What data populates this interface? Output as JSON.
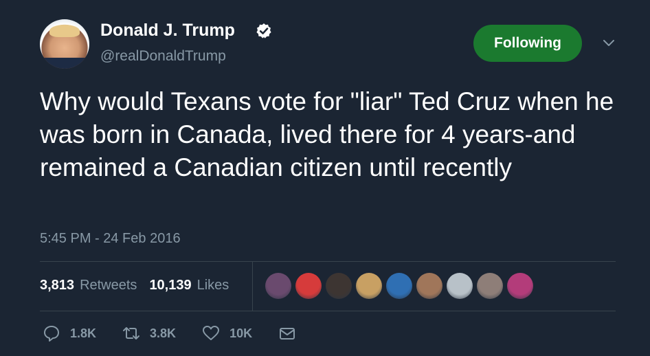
{
  "author": {
    "name": "Donald J. Trump",
    "handle": "@realDonaldTrump"
  },
  "follow_button": {
    "label": "Following"
  },
  "tweet": {
    "text": "Why would Texans vote for \"liar\" Ted Cruz when he was born in Canada, lived there for 4 years-and remained a Canadian citizen until recently",
    "timestamp": "5:45 PM - 24 Feb 2016"
  },
  "stats": {
    "retweets_count": "3,813",
    "retweets_label": "Retweets",
    "likes_count": "10,139",
    "likes_label": "Likes"
  },
  "actions": {
    "reply_count": "1.8K",
    "retweet_count": "3.8K",
    "like_count": "10K"
  },
  "colors": {
    "background": "#1b2533",
    "following_green": "#1b7a2f",
    "muted_text": "#8899a6",
    "divider": "#38444d"
  },
  "icons": {
    "verified": "verified-badge-icon",
    "menu": "chevron-down-icon",
    "reply": "reply-icon",
    "retweet": "retweet-icon",
    "like": "heart-icon",
    "dm": "envelope-icon"
  },
  "liker_avatars": [
    {
      "color": "#6a4a6e"
    },
    {
      "color": "#d63b3b"
    },
    {
      "color": "#3d3532"
    },
    {
      "color": "#c8a063"
    },
    {
      "color": "#2f6fb3"
    },
    {
      "color": "#a0765a"
    },
    {
      "color": "#b8c1c8"
    },
    {
      "color": "#8e7e78"
    },
    {
      "color": "#b33c7a"
    }
  ]
}
